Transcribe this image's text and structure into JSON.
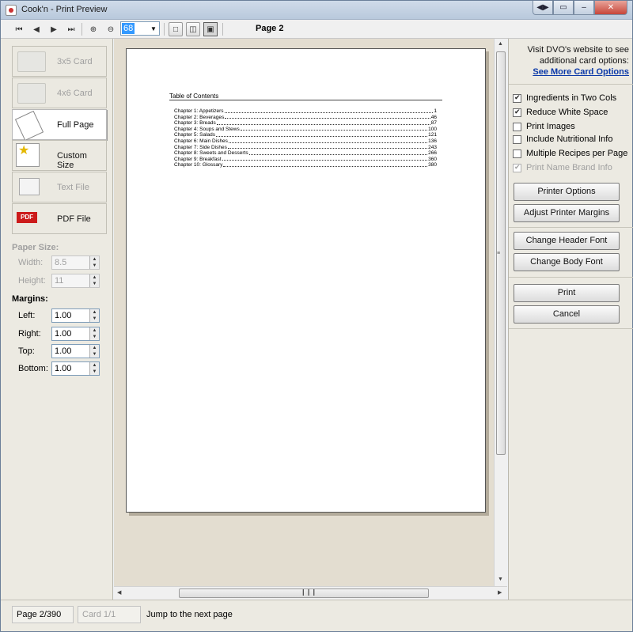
{
  "window": {
    "title": "Cook'n - Print Preview",
    "buttons": [
      "◀▶",
      "▭",
      "–",
      "✕"
    ]
  },
  "toolbar": {
    "zoom_value": "68",
    "page_label": "Page 2"
  },
  "left": {
    "card_options": [
      {
        "label": "3x5 Card",
        "enabled": false
      },
      {
        "label": "4x6 Card",
        "enabled": false
      },
      {
        "label": "Full Page",
        "enabled": true,
        "selected": true
      },
      {
        "label": "Custom Size",
        "enabled": true
      },
      {
        "label": "Text File",
        "enabled": false
      },
      {
        "label": "PDF File",
        "enabled": true
      }
    ],
    "paper_size_label": "Paper Size:",
    "width_label": "Width:",
    "width_value": "8.5",
    "height_label": "Height:",
    "height_value": "11",
    "margins_label": "Margins:",
    "left_label": "Left:",
    "left_value": "1.00",
    "right_label": "Right:",
    "right_value": "1.00",
    "top_label": "Top:",
    "top_value": "1.00",
    "bottom_label": "Bottom:",
    "bottom_value": "1.00"
  },
  "preview": {
    "toc_title": "Table of Contents",
    "toc": [
      {
        "title": "Chapter 1: Appetizers",
        "page": "1"
      },
      {
        "title": "Chapter 2: Beverages",
        "page": "46"
      },
      {
        "title": "Chapter 3: Breads",
        "page": "87"
      },
      {
        "title": "Chapter 4: Soups and Stews",
        "page": "100"
      },
      {
        "title": "Chapter 5: Salads",
        "page": "121"
      },
      {
        "title": "Chapter 6: Main Dishes",
        "page": "136"
      },
      {
        "title": "Chapter 7: Side Dishes",
        "page": "243"
      },
      {
        "title": "Chapter 8: Sweets and Desserts",
        "page": "266"
      },
      {
        "title": "Chapter 9: Breakfast",
        "page": "360"
      },
      {
        "title": "Chapter 10: Glossary",
        "page": "380"
      }
    ]
  },
  "right": {
    "visit_text": "Visit DVO's website to see additional card options:",
    "see_more_link": "See More Card Options",
    "options": [
      {
        "label": "Ingredients in Two Cols",
        "checked": true,
        "enabled": true
      },
      {
        "label": "Reduce White Space",
        "checked": true,
        "enabled": true
      },
      {
        "label": "Print Images",
        "checked": false,
        "enabled": true
      },
      {
        "label": "Include Nutritional Info",
        "checked": false,
        "enabled": true
      },
      {
        "label": "Multiple Recipes per Page",
        "checked": false,
        "enabled": true
      },
      {
        "label": "Print Name Brand Info",
        "checked": true,
        "enabled": false
      }
    ],
    "printer_options": "Printer Options",
    "adjust_margins": "Adjust Printer Margins",
    "change_header_font": "Change Header Font",
    "change_body_font": "Change Body Font",
    "print": "Print",
    "cancel": "Cancel"
  },
  "status": {
    "page_count": "Page 2/390",
    "card_count": "Card 1/1",
    "hint": "Jump to the next page"
  }
}
